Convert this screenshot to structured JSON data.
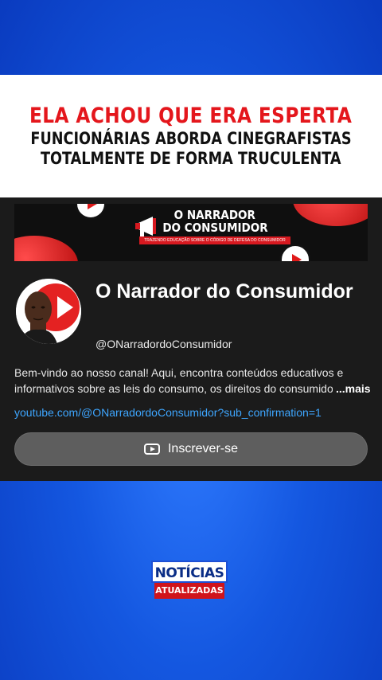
{
  "headline": {
    "line1": "ELA ACHOU QUE ERA ESPERTA",
    "line2": "FUNCIONÁRIAS ABORDA CINEGRAFISTAS",
    "line3": "TOTALMENTE DE FORMA TRUCULENTA"
  },
  "banner": {
    "title_line1": "O NARRADOR",
    "title_line2": "DO CONSUMIDOR",
    "subtitle": "TRAZENDO EDUCAÇÃO SOBRE O CÓDIGO DE DEFESA DO CONSUMIDOR"
  },
  "channel": {
    "name": "O Narrador do Consumidor",
    "handle": "@ONarradordoConsumidor",
    "description": "Bem-vindo ao nosso canal! Aqui, encontra conteúdos educativos e informativos sobre as leis do consumo, os direitos do consumidor",
    "more_label": "...mais",
    "link": "youtube.com/@ONarradordoConsumidor?sub_confirmation=1",
    "subscribe_label": "Inscrever-se"
  },
  "badge": {
    "top": "NOTÍCIAS",
    "bottom": "ATUALIZADAS"
  },
  "colors": {
    "accent_red": "#e4161c",
    "link_blue": "#3ea6ff",
    "background_blue": "#1457e0"
  }
}
